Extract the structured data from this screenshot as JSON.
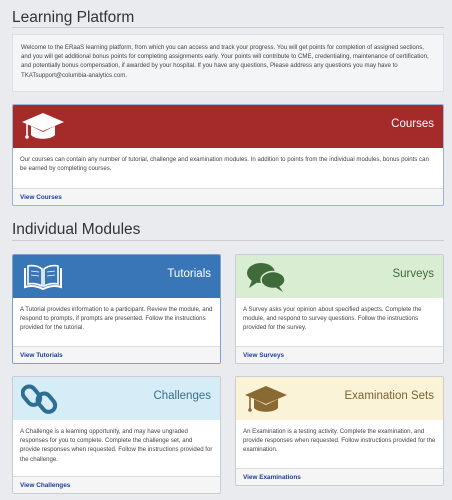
{
  "header": {
    "title": "Learning Platform"
  },
  "welcome": {
    "text": "Welcome to the ERaaS learning platform, from which you can access and track your progress. You will get points for completion of assigned sections, and you will get additional bonus points for completing assignments early. Your points will contribute to CME, credentialing, maintenance of certification, and potentially bonus compensation, if awarded by your hospital. If you have any questions, Please address any questions you may have to TKATsupport@columbia-analytics.com."
  },
  "courses": {
    "title": "Courses",
    "icon": "graduation-cap-icon",
    "description": "Our courses can contain any number of tutorial, challenge and examination modules. In addition to points from the individual modules, bonus points can be earned by completing courses.",
    "link": "View Courses",
    "color": "#a52a2a"
  },
  "modules_section": {
    "title": "Individual Modules"
  },
  "modules": {
    "tutorials": {
      "title": "Tutorials",
      "icon": "book-icon",
      "description": "A Tutorial provides information to a participant. Review the module, and respond to prompts, if prompts are presented. Follow the instructions provided for the tutorial.",
      "link": "View Tutorials",
      "color": "#3876b7"
    },
    "surveys": {
      "title": "Surveys",
      "icon": "chat-bubbles-icon",
      "description": "A Survey asks your opinion about specified aspects. Complete the module, and respond to survey questions. Follow the instructions provided for the survey.",
      "link": "View Surveys",
      "color": "#d9edd2"
    },
    "challenges": {
      "title": "Challenges",
      "icon": "chain-link-icon",
      "description": "A Challenge is a learning opportunity, and may have ungraded responses for you to complete. Complete the challenge set, and provide responses when requested. Follow the instructions provided for the challenge.",
      "link": "View Challenges",
      "color": "#d6ecf6"
    },
    "exams": {
      "title": "Examination Sets",
      "icon": "graduation-cap-icon",
      "description": "An Examination is a testing activity. Complete the examination, and provide responses when requested. Follow instructions provided for the examination.",
      "link": "View Examinations",
      "color": "#fbf3d7"
    }
  }
}
